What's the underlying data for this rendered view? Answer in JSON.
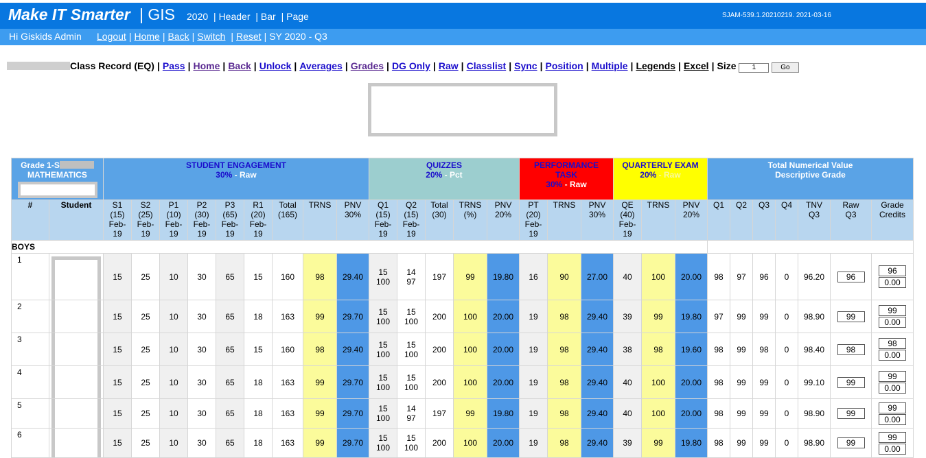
{
  "header": {
    "brand_bold": "Make IT Smarter",
    "brand_gis": "| GIS",
    "year": "2020",
    "links": [
      "| Header",
      "| Bar",
      "| Page"
    ],
    "version": "SJAM-539.1.20210219. 2021-03-16"
  },
  "subbar": {
    "greeting": "Hi Giskids Admin",
    "nav": [
      "Logout",
      "Home",
      "Back",
      "Switch"
    ],
    "reset": "Reset",
    "sy": "SY 2020 - Q3"
  },
  "toolbar": {
    "title": "Class Record (EQ)",
    "links": [
      "Pass",
      "Home",
      "Back",
      "Unlock",
      "Averages",
      "Grades",
      "DG Only",
      "Raw",
      "Classlist",
      "Sync",
      "Position",
      "Multiple"
    ],
    "legends": "Legends",
    "excel": "Excel",
    "size_label": "Size",
    "size_value": "1",
    "go_label": "Go"
  },
  "groups": {
    "subject_line1": "Grade 1-S",
    "subject_line2": "MATHEMATICS",
    "se_title": "STUDENT ENGAGEMENT",
    "se_pct": "30%",
    "se_note": "- Raw",
    "qz_title": "QUIZZES",
    "qz_pct": "20%",
    "qz_note": "- Pct",
    "pt_title": "PERFORMANCE TASK",
    "pt_pct": "30%",
    "pt_note": "- Raw",
    "qe_title": "QUARTERLY EXAM",
    "qe_pct": "20%",
    "qe_note": "- Raw",
    "tot_line1": "Total Numerical Value",
    "tot_line2": "Descriptive Grade"
  },
  "columns": [
    {
      "h": "#"
    },
    {
      "h": "Student"
    },
    {
      "h": "S1\n(15)\nFeb-\n19"
    },
    {
      "h": "S2\n(25)\nFeb-\n19"
    },
    {
      "h": "P1\n(10)\nFeb-\n19"
    },
    {
      "h": "P2\n(30)\nFeb-\n19"
    },
    {
      "h": "P3\n(65)\nFeb-\n19"
    },
    {
      "h": "R1\n(20)\nFeb-\n19"
    },
    {
      "h": "Total\n(165)"
    },
    {
      "h": "TRNS"
    },
    {
      "h": "PNV\n30%"
    },
    {
      "h": "Q1\n(15)\nFeb-\n19"
    },
    {
      "h": "Q2\n(15)\nFeb-\n19"
    },
    {
      "h": "Total\n(30)"
    },
    {
      "h": "TRNS\n(%)"
    },
    {
      "h": "PNV\n20%"
    },
    {
      "h": "PT\n(20)\nFeb-\n19"
    },
    {
      "h": "TRNS"
    },
    {
      "h": "PNV\n30%"
    },
    {
      "h": "QE\n(40)\nFeb-\n19"
    },
    {
      "h": "TRNS"
    },
    {
      "h": "PNV\n20%"
    },
    {
      "h": "Q1"
    },
    {
      "h": "Q2"
    },
    {
      "h": "Q3"
    },
    {
      "h": "Q4"
    },
    {
      "h": "TNV\nQ3"
    },
    {
      "h": "Raw\nQ3"
    },
    {
      "h": "Grade\nCredits"
    }
  ],
  "section": "BOYS",
  "rows": [
    {
      "n": "1",
      "s": [
        "15",
        "25",
        "10",
        "30",
        "65",
        "15",
        "160",
        "98",
        "29.40"
      ],
      "q": [
        "15\n100",
        "14\n97",
        "197",
        "99",
        "19.80"
      ],
      "pt": [
        "16",
        "90",
        "27.00"
      ],
      "qe": [
        "40",
        "100",
        "20.00"
      ],
      "t": [
        "98",
        "97",
        "96",
        "0",
        "96.20"
      ],
      "raw": "96",
      "gc": [
        "96",
        "0.00"
      ]
    },
    {
      "n": "2",
      "s": [
        "15",
        "25",
        "10",
        "30",
        "65",
        "18",
        "163",
        "99",
        "29.70"
      ],
      "q": [
        "15\n100",
        "15\n100",
        "200",
        "100",
        "20.00"
      ],
      "pt": [
        "19",
        "98",
        "29.40"
      ],
      "qe": [
        "39",
        "99",
        "19.80"
      ],
      "t": [
        "97",
        "99",
        "99",
        "0",
        "98.90"
      ],
      "raw": "99",
      "gc": [
        "99",
        "0.00"
      ]
    },
    {
      "n": "3",
      "s": [
        "15",
        "25",
        "10",
        "30",
        "65",
        "15",
        "160",
        "98",
        "29.40"
      ],
      "q": [
        "15\n100",
        "15\n100",
        "200",
        "100",
        "20.00"
      ],
      "pt": [
        "19",
        "98",
        "29.40"
      ],
      "qe": [
        "38",
        "98",
        "19.60"
      ],
      "t": [
        "98",
        "99",
        "98",
        "0",
        "98.40"
      ],
      "raw": "98",
      "gc": [
        "98",
        "0.00"
      ]
    },
    {
      "n": "4",
      "s": [
        "15",
        "25",
        "10",
        "30",
        "65",
        "18",
        "163",
        "99",
        "29.70"
      ],
      "q": [
        "15\n100",
        "15\n100",
        "200",
        "100",
        "20.00"
      ],
      "pt": [
        "19",
        "98",
        "29.40"
      ],
      "qe": [
        "40",
        "100",
        "20.00"
      ],
      "t": [
        "98",
        "99",
        "99",
        "0",
        "99.10"
      ],
      "raw": "99",
      "gc": [
        "99",
        "0.00"
      ]
    },
    {
      "n": "5",
      "s": [
        "15",
        "25",
        "10",
        "30",
        "65",
        "18",
        "163",
        "99",
        "29.70"
      ],
      "q": [
        "15\n100",
        "14\n97",
        "197",
        "99",
        "19.80"
      ],
      "pt": [
        "19",
        "98",
        "29.40"
      ],
      "qe": [
        "40",
        "100",
        "20.00"
      ],
      "t": [
        "98",
        "99",
        "99",
        "0",
        "98.90"
      ],
      "raw": "99",
      "gc": [
        "99",
        "0.00"
      ]
    },
    {
      "n": "6",
      "s": [
        "15",
        "25",
        "10",
        "30",
        "65",
        "18",
        "163",
        "99",
        "29.70"
      ],
      "q": [
        "15\n100",
        "15\n100",
        "200",
        "100",
        "20.00"
      ],
      "pt": [
        "19",
        "98",
        "29.40"
      ],
      "qe": [
        "39",
        "99",
        "19.80"
      ],
      "t": [
        "98",
        "99",
        "99",
        "0",
        "98.90"
      ],
      "raw": "99",
      "gc": [
        "99",
        "0.00"
      ]
    }
  ]
}
